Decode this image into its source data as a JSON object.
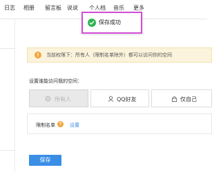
{
  "nav": {
    "items": [
      "日志",
      "相册",
      "留言板",
      "说说",
      "个人档",
      "音乐",
      "更多"
    ]
  },
  "toast": {
    "text": "保存成功",
    "icon": "check-circle-icon",
    "icon_color": "#2fb451",
    "border_color": "#d44cd6"
  },
  "notice": {
    "icon": "info-icon",
    "icon_glyph": "!",
    "text": "当前权限下：所有人（限制名单除外）都可以访问你的空间"
  },
  "access": {
    "label": "设置谁能访问我的空间：",
    "options": [
      {
        "label": "所有人",
        "icon": "globe-icon",
        "selected": true
      },
      {
        "label": "QQ好友",
        "icon": "friends-icon",
        "selected": false
      },
      {
        "label": "仅自己",
        "icon": "lock-icon",
        "selected": false
      }
    ]
  },
  "restriction": {
    "label": "限制名单",
    "help_glyph": "?",
    "link": "设置"
  },
  "save_label": "保存",
  "colors": {
    "accent": "#3a8ee6",
    "notice_bg": "#fbf3dc",
    "warning": "#f2a53a"
  }
}
